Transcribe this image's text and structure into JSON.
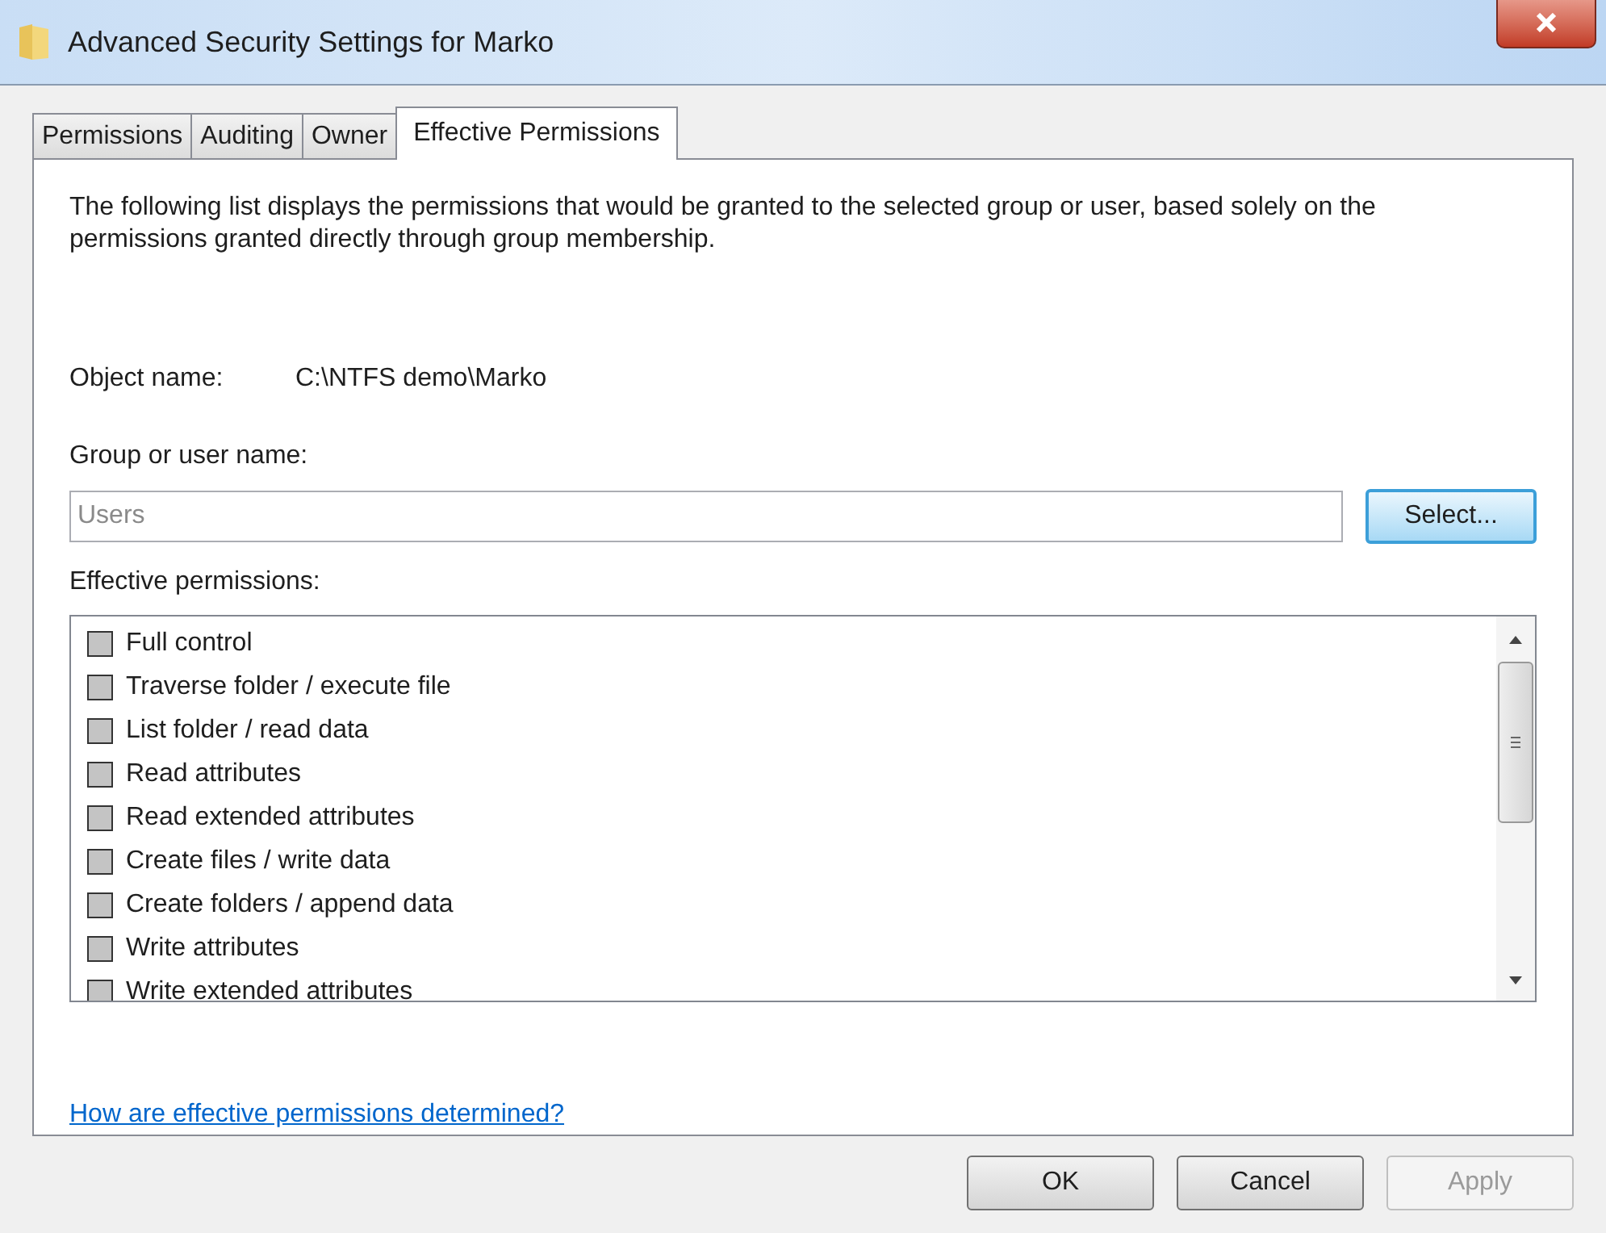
{
  "window": {
    "title": "Advanced Security Settings for Marko"
  },
  "tabs": [
    {
      "label": "Permissions",
      "selected": false
    },
    {
      "label": "Auditing",
      "selected": false
    },
    {
      "label": "Owner",
      "selected": false
    },
    {
      "label": "Effective Permissions",
      "selected": true
    }
  ],
  "description": "The following list displays the permissions that would be granted to the selected group or user, based solely on the permissions granted directly through group membership.",
  "object_name": {
    "label": "Object name:",
    "value": "C:\\NTFS demo\\Marko"
  },
  "group_field": {
    "label": "Group or user name:",
    "placeholder": "Users",
    "button": "Select..."
  },
  "permissions_label": "Effective permissions:",
  "permissions": [
    {
      "label": "Full control",
      "checked": false
    },
    {
      "label": "Traverse folder / execute file",
      "checked": false
    },
    {
      "label": "List folder / read data",
      "checked": false
    },
    {
      "label": "Read attributes",
      "checked": false
    },
    {
      "label": "Read extended attributes",
      "checked": false
    },
    {
      "label": "Create files / write data",
      "checked": false
    },
    {
      "label": "Create folders / append data",
      "checked": false
    },
    {
      "label": "Write attributes",
      "checked": false
    },
    {
      "label": "Write extended attributes",
      "checked": false
    }
  ],
  "help_link": "How are effective permissions determined?",
  "buttons": [
    {
      "label": "OK",
      "disabled": false
    },
    {
      "label": "Cancel",
      "disabled": false
    },
    {
      "label": "Apply",
      "disabled": true
    }
  ]
}
